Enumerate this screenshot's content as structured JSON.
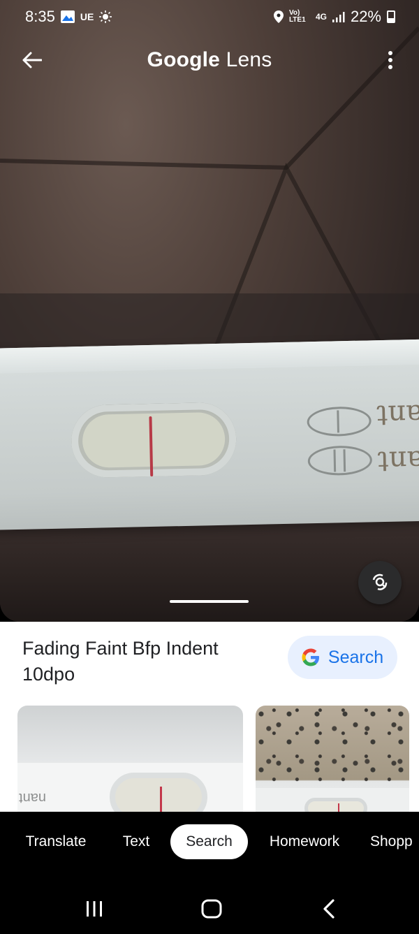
{
  "status_bar": {
    "time": "8:35",
    "carrier_label": "UE",
    "network_label": "Vo) LTE1",
    "network_type": "4G",
    "battery": "22%"
  },
  "app_bar": {
    "title_brand": "Google",
    "title_product": "Lens"
  },
  "photo": {
    "strip_text": "nant"
  },
  "result": {
    "title": "Fading Faint Bfp Indent 10dpo",
    "search_button_label": "Search",
    "thumb1_text": "nant"
  },
  "modes": {
    "items": [
      "Translate",
      "Text",
      "Search",
      "Homework",
      "Shopp"
    ],
    "selected": "Search"
  },
  "colors": {
    "search_chip_bg": "#e8f0fe",
    "search_chip_text": "#1a73e8",
    "active_tab_bg": "#ffffff"
  }
}
